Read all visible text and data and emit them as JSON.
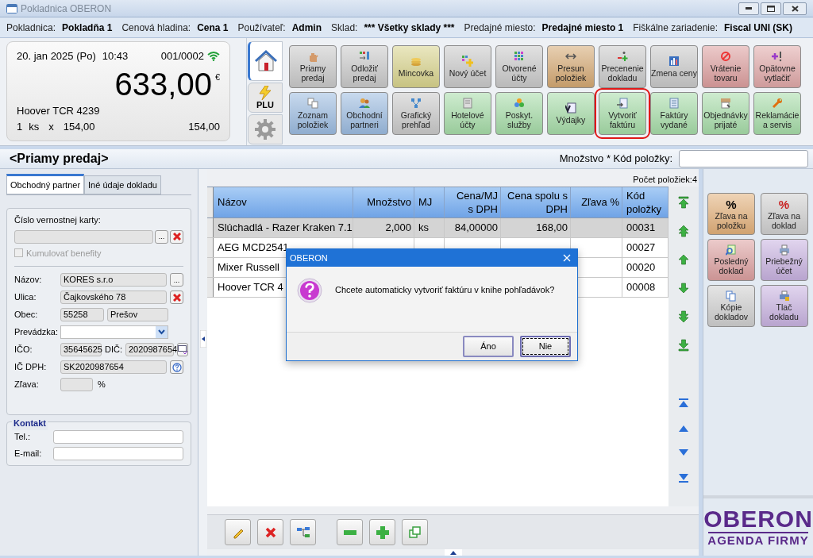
{
  "window": {
    "title": "Pokladnica OBERON"
  },
  "info_bar": [
    {
      "label": "Pokladnica:",
      "value": "Pokladňa 1"
    },
    {
      "label": "Cenová hladina:",
      "value": "Cena 1"
    },
    {
      "label": "Používateľ:",
      "value": "Admin"
    },
    {
      "label": "Sklad:",
      "value": "*** Všetky sklady ***"
    },
    {
      "label": "Predajné miesto:",
      "value": "Predajné miesto 1"
    },
    {
      "label": "Fiškálne zariadenie:",
      "value": "Fiscal UNI (SK)"
    }
  ],
  "display": {
    "date": "20. jan 2025 (Po)",
    "time": "10:43",
    "document": "001/0002",
    "total": "633,00",
    "currency": "€",
    "item": "Hoover TCR 4239",
    "quantity": "1",
    "unit": "ks",
    "times": "x",
    "unit_price": "154,00",
    "line_total": "154,00"
  },
  "side_tabs": [
    {
      "kind": "home",
      "selected": true
    },
    {
      "kind": "plu",
      "label": "PLU",
      "selected": false
    },
    {
      "kind": "settings",
      "selected": false
    }
  ],
  "function_buttons": [
    [
      {
        "label": "Priamy\npredaj",
        "color": "#c9c9c9",
        "highlighted": false
      },
      {
        "label": "Odložiť\npredaj",
        "color": "#c9c9c9",
        "highlighted": false
      },
      {
        "label": "Mincovka",
        "color": "#d8d38c",
        "highlighted": false
      },
      {
        "label": "Nový účet",
        "color": "#c9c9c9",
        "highlighted": false
      },
      {
        "label": "Otvorené\núčty",
        "color": "#c9c9c9",
        "highlighted": false
      },
      {
        "label": "Presun\npoložiek",
        "color": "#d4a872",
        "highlighted": false
      },
      {
        "label": "Precenenie\ndokladu",
        "color": "#c9c9c9",
        "highlighted": false
      },
      {
        "label": "Zmena ceny",
        "color": "#c9c9c9",
        "highlighted": false
      },
      {
        "label": "Vrátenie\ntovaru",
        "color": "#dc9e9e",
        "highlighted": false
      },
      {
        "label": "Opätovne\nvytlačiť",
        "color": "#e0a8a8",
        "highlighted": false
      }
    ],
    [
      {
        "label": "Zoznam\npoložiek",
        "color": "#9bbbe0",
        "highlighted": false
      },
      {
        "label": "Obchodní\npartneri",
        "color": "#9bbbe0",
        "highlighted": false
      },
      {
        "label": "Grafický\nprehľad",
        "color": "#c9c9c9",
        "highlighted": false
      },
      {
        "label": "Hotelové\núčty",
        "color": "#a6dca8",
        "highlighted": false
      },
      {
        "label": "Poskyt.\nslužby",
        "color": "#a6dca8",
        "highlighted": false
      },
      {
        "label": "Výdajky",
        "color": "#a6dca8",
        "highlighted": false
      },
      {
        "label": "Vytvoriť\nfaktúru",
        "color": "#a6dca8",
        "highlighted": true
      },
      {
        "label": "Faktúry\nvydané",
        "color": "#a6dca8",
        "highlighted": false
      },
      {
        "label": "Objednávky\nprijaté",
        "color": "#a6dca8",
        "highlighted": false
      },
      {
        "label": "Reklamácie\na servis",
        "color": "#a6dca8",
        "highlighted": false
      }
    ]
  ],
  "header": {
    "title": "<Priamy predaj>",
    "quantity_label": "Množstvo * Kód položky:"
  },
  "left_panel": {
    "tabs": [
      {
        "label": "Obchodný partner",
        "selected": true
      },
      {
        "label": "Iné údaje dokladu",
        "selected": false
      }
    ],
    "loyalty": {
      "label": "Číslo vernostnej karty:",
      "button": "..."
    },
    "benefits": {
      "label": "Kumulovať benefity",
      "checked": false,
      "disabled": true
    },
    "rows": [
      {
        "kind": "text",
        "label": "Názov:",
        "value": "KORES s.r.o",
        "button": {
          "kind": "more",
          "label": "..."
        }
      },
      {
        "kind": "text",
        "label": "Ulica:",
        "value": "Čajkovského 78",
        "button": {
          "kind": "clear"
        }
      },
      {
        "kind": "pair",
        "label": "Obec:",
        "values": [
          "55258",
          "Prešov"
        ]
      },
      {
        "kind": "select",
        "label": "Prevádzka:"
      },
      {
        "kind": "ids",
        "label": "IČO:",
        "value": "35645625",
        "label2": "DIČ:",
        "value2": "2020987654",
        "button": {
          "kind": "lookup"
        }
      },
      {
        "kind": "text",
        "label": "IČ DPH:",
        "value": "SK2020987654",
        "button": {
          "kind": "help"
        }
      },
      {
        "kind": "percent",
        "label": "Zľava:",
        "unit": "%"
      }
    ],
    "contact": {
      "title": "Kontakt",
      "fields": [
        {
          "label": "Tel.:"
        },
        {
          "label": "E-mail:"
        }
      ]
    }
  },
  "table": {
    "count": "Počet položiek:4",
    "columns": [
      "Názov",
      "Množstvo",
      "MJ",
      "Cena/MJ\ns DPH",
      "Cena spolu s\nDPH",
      "Zľava %",
      "Kód\npoložky"
    ],
    "rows": [
      {
        "selected": true,
        "cells": [
          "Slúchadlá - Razer Kraken 7.1",
          "2,000",
          "ks",
          "84,00000",
          "168,00",
          null,
          "00031"
        ]
      },
      {
        "selected": false,
        "cells": [
          "AEG MCD2541",
          null,
          null,
          null,
          null,
          null,
          "00027"
        ]
      },
      {
        "selected": false,
        "cells": [
          "Mixer Russell",
          null,
          null,
          null,
          null,
          null,
          "00020"
        ]
      },
      {
        "selected": false,
        "cells": [
          "Hoover TCR 4",
          null,
          null,
          null,
          null,
          null,
          "00008"
        ]
      }
    ]
  },
  "right_buttons": [
    {
      "label": "Zľava na\npoložku",
      "symbol": "%",
      "color": "#e2b07a"
    },
    {
      "label": "Zľava na\ndoklad",
      "symbol": "%",
      "color": "#cfcfcf"
    },
    {
      "label": "Posledný\ndoklad",
      "color": "#dca0a0"
    },
    {
      "label": "Priebežný\núčet",
      "color": "#c8b2e0"
    },
    {
      "label": "Kópie\ndokladov",
      "color": "#cfcfcf"
    },
    {
      "label": "Tlač\ndokladu",
      "color": "#c8b2e0"
    }
  ],
  "logo": {
    "name": "OBERON",
    "tagline": "AGENDA FIRMY"
  },
  "dialog": {
    "title": "OBERON",
    "message": "Chcete automaticky vytvoriť faktúru v knihe pohľadávok?",
    "buttons": [
      {
        "label": "Áno",
        "focused": false
      },
      {
        "label": "Nie",
        "focused": true
      }
    ]
  }
}
